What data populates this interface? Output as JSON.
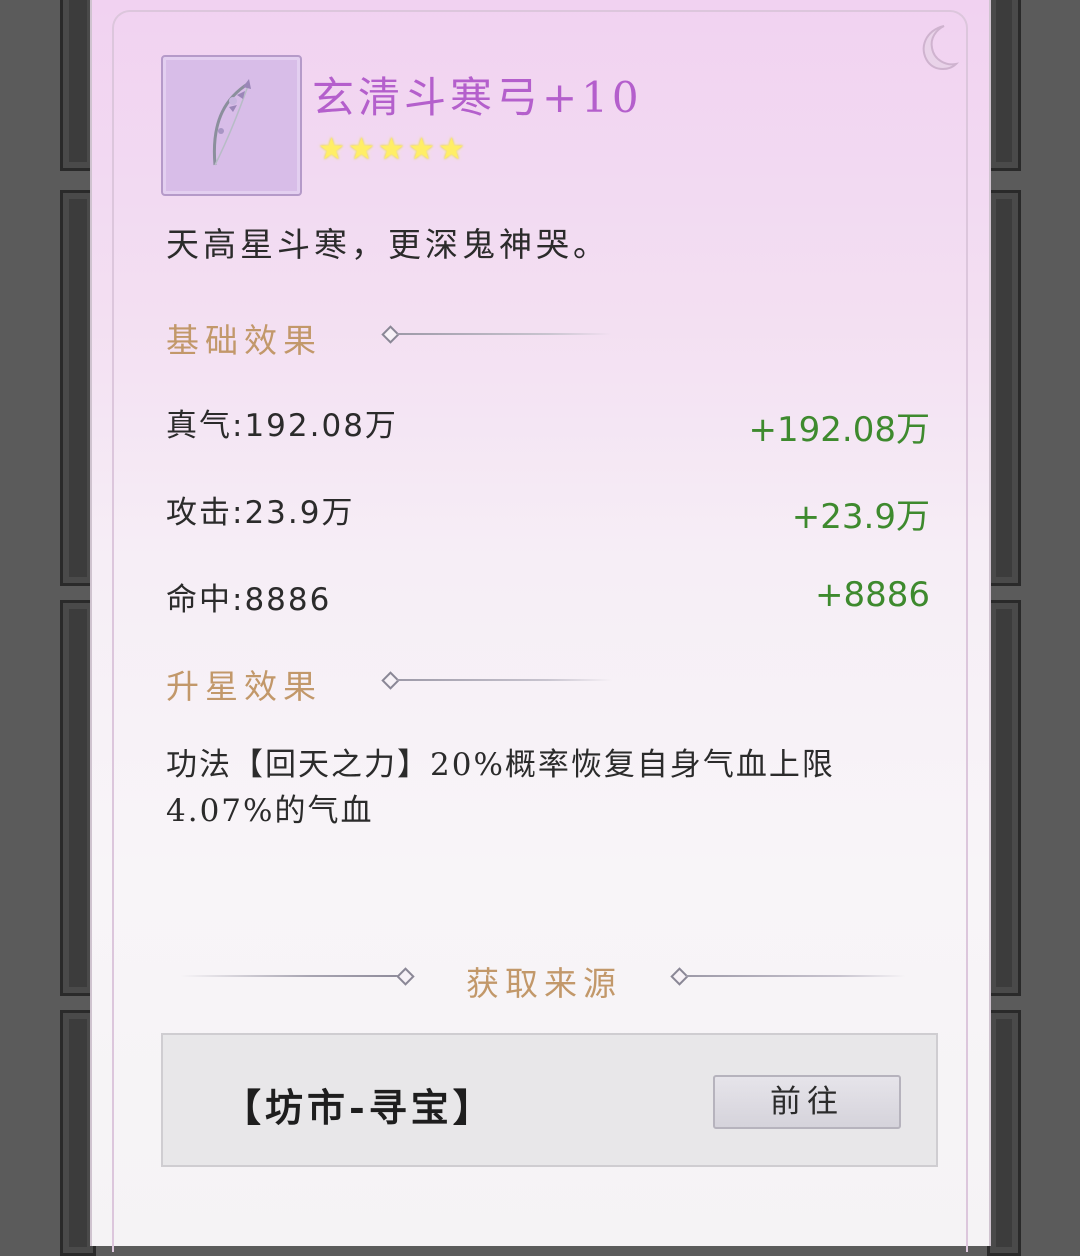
{
  "item": {
    "name": "玄清斗寒弓+10",
    "stars": 5,
    "flavor": "天高星斗寒，更深鬼神哭。"
  },
  "sections": {
    "base_effect": "基础效果",
    "star_effect": "升星效果",
    "source": "获取来源"
  },
  "stats": [
    {
      "label": "真气:192.08万",
      "bonus": "+192.08万"
    },
    {
      "label": "攻击:23.9万",
      "bonus": "+23.9万"
    },
    {
      "label": "命中:8886",
      "bonus": "+8886"
    }
  ],
  "star_effect_text": "功法【回天之力】20%概率恢复自身气血上限4.07%的气血",
  "source_entry": {
    "name": "【坊市-寻宝】",
    "button": "前往"
  },
  "icons": [
    "bow-icon",
    "star-icon",
    "moon-emblem-icon"
  ]
}
